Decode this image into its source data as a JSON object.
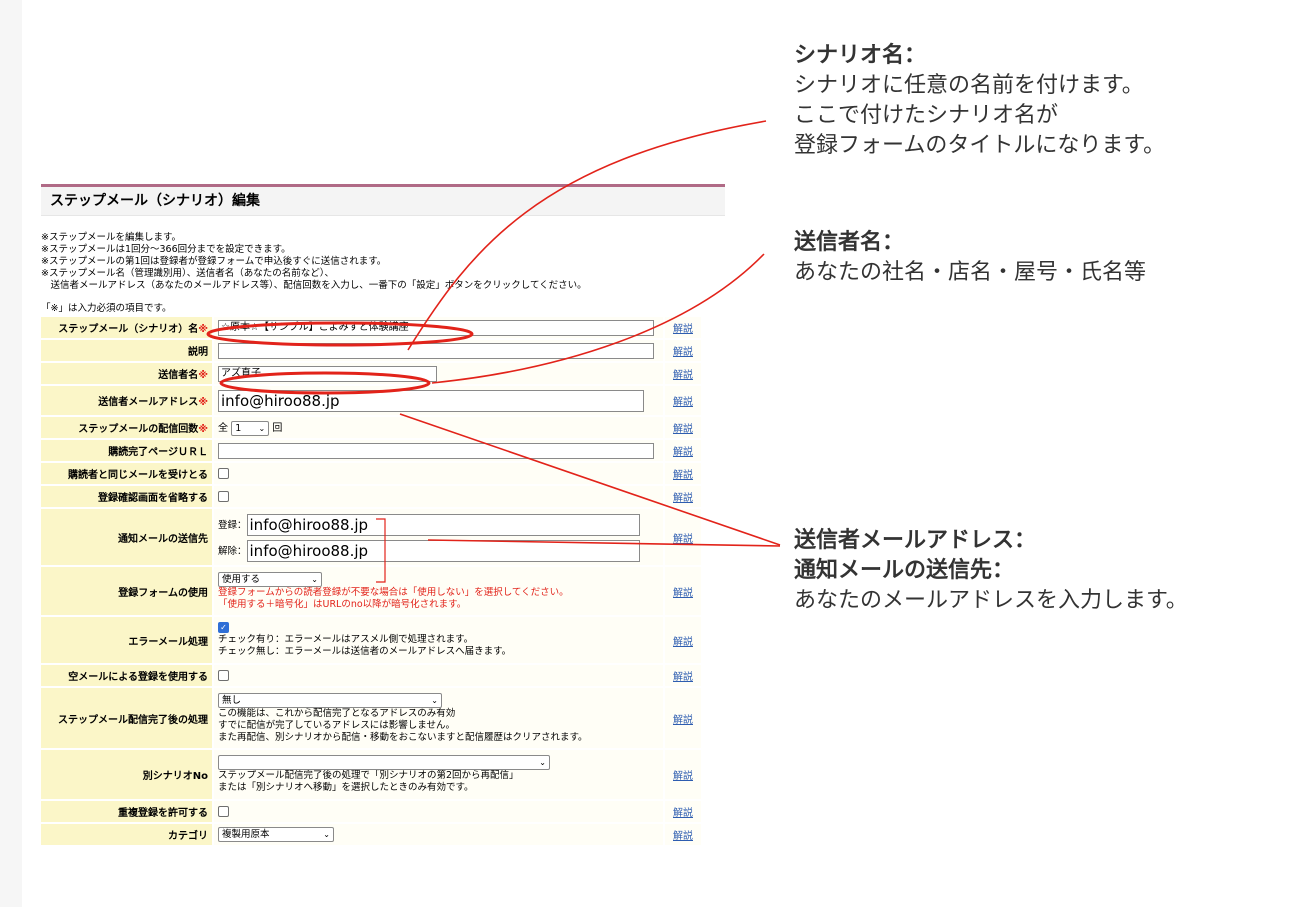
{
  "panel": {
    "title": "ステップメール（シナリオ）編集",
    "notes": [
      "※ステップメールを編集します。",
      "※ステップメールは1回分〜366回分までを設定できます。",
      "※ステップメールの第1回は登録者が登録フォームで申込後すぐに送信されます。",
      "※ステップメール名（管理識別用）、送信者名（あなたの名前など）、",
      "　送信者メールアドレス（あなたのメールアドレス等）、配信回数を入力し、一番下の「設定」ボタンをクリックしてください。"
    ],
    "required_note": "「※」は入力必須の項目です。",
    "required_mark": "※",
    "help_label": "解説"
  },
  "rows": {
    "scenario_name": {
      "label": "ステップメール（シナリオ）名",
      "value": "☆原本☆【サンプル】こよみすと体験講座"
    },
    "description": {
      "label": "説明",
      "value": ""
    },
    "sender_name": {
      "label": "送信者名",
      "value": "アズ直子"
    },
    "sender_email": {
      "label": "送信者メールアドレス",
      "value": "info@hiroo88.jp"
    },
    "delivery_count": {
      "label": "ステップメールの配信回数",
      "prefix": "全",
      "value": "1",
      "suffix": "回"
    },
    "complete_url": {
      "label": "購読完了ページＵＲＬ",
      "value": ""
    },
    "same_mail": {
      "label": "購読者と同じメールを受けとる"
    },
    "skip_confirm": {
      "label": "登録確認画面を省略する"
    },
    "notify": {
      "label": "通知メールの送信先",
      "register_label": "登録：",
      "register_value": "info@hiroo88.jp",
      "cancel_label": "解除：",
      "cancel_value": "info@hiroo88.jp"
    },
    "form_use": {
      "label": "登録フォームの使用",
      "value": "使用する",
      "note1": "登録フォームからの読者登録が不要な場合は「使用しない」を選択してください。",
      "note2": "「使用する＋暗号化」はURLのno以降が暗号化されます。"
    },
    "error_mail": {
      "label": "エラーメール処理",
      "note1": "チェック有り：エラーメールはアスメル側で処理されます。",
      "note2": "チェック無し：エラーメールは送信者のメールアドレスへ届きます。"
    },
    "empty_mail": {
      "label": "空メールによる登録を使用する"
    },
    "after_complete": {
      "label": "ステップメール配信完了後の処理",
      "value": "無し",
      "note1": "この機能は、これから配信完了となるアドレスのみ有効",
      "note2": "すでに配信が完了しているアドレスには影響しません。",
      "note3": "また再配信、別シナリオから配信・移動をおこないますと配信履歴はクリアされます。"
    },
    "other_scenario": {
      "label": "別シナリオNo",
      "value": "",
      "note1": "ステップメール配信完了後の処理で「別シナリオの第2回から再配信」",
      "note2": "または「別シナリオへ移動」を選択したときのみ有効です。"
    },
    "allow_duplicate": {
      "label": "重複登録を許可する"
    },
    "category": {
      "label": "カテゴリ",
      "value": "複製用原本"
    }
  },
  "annotations": {
    "scenario": {
      "heading": "シナリオ名：",
      "line1": "シナリオに任意の名前を付けます。",
      "line2": "ここで付けたシナリオ名が",
      "line3": "登録フォームのタイトルになります。"
    },
    "sender": {
      "heading": "送信者名：",
      "line1": "あなたの社名・店名・屋号・氏名等"
    },
    "email": {
      "heading1": "送信者メールアドレス：",
      "heading2": "通知メールの送信先：",
      "line1": "あなたのメールアドレスを入力します。"
    }
  },
  "colors": {
    "label_bg": "#fbf6c8",
    "title_border": "#b06a86",
    "annotation_red": "#e2231a",
    "link_blue": "#2e5db0"
  }
}
